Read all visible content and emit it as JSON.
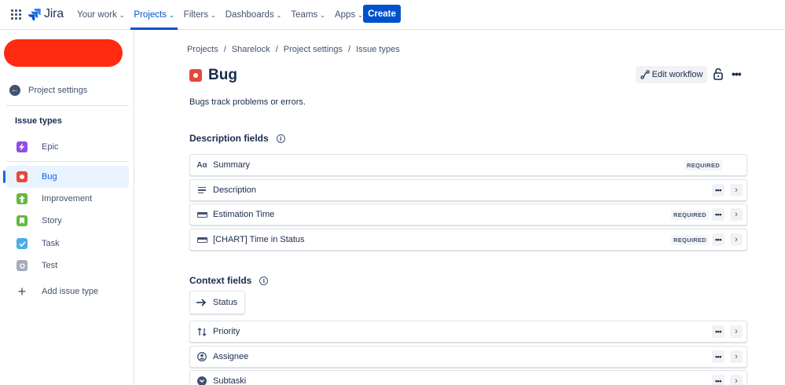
{
  "nav": {
    "logo": "Jira",
    "items": [
      {
        "label": "Your work",
        "active": false
      },
      {
        "label": "Projects",
        "active": true
      },
      {
        "label": "Filters",
        "active": false
      },
      {
        "label": "Dashboards",
        "active": false
      },
      {
        "label": "Teams",
        "active": false
      },
      {
        "label": "Apps",
        "active": false
      }
    ],
    "create": "Create"
  },
  "sidebar": {
    "back_label": "Project settings",
    "heading": "Issue types",
    "items": [
      {
        "label": "Epic",
        "icon": "epic-icon",
        "color": "#904ee2"
      },
      {
        "label": "Bug",
        "icon": "bug-icon",
        "color": "#e5493a",
        "selected": true
      },
      {
        "label": "Improvement",
        "icon": "improvement-icon",
        "color": "#63ba3c"
      },
      {
        "label": "Story",
        "icon": "story-icon",
        "color": "#63ba3c"
      },
      {
        "label": "Task",
        "icon": "task-icon",
        "color": "#4bade8"
      },
      {
        "label": "Test",
        "icon": "test-icon",
        "color": "#a5adba"
      }
    ],
    "add_label": "Add issue type"
  },
  "breadcrumb": [
    "Projects",
    "Sharelock",
    "Project settings",
    "Issue types"
  ],
  "page": {
    "title": "Bug",
    "subtitle": "Bugs track problems or errors.",
    "edit_workflow": "Edit workflow"
  },
  "description_fields": {
    "heading": "Description fields",
    "items": [
      {
        "label": "Summary",
        "required": "REQUIRED",
        "icon": "text-icon"
      },
      {
        "label": "Description",
        "required": "",
        "icon": "paragraph-icon"
      },
      {
        "label": "Estimation Time",
        "required": "REQUIRED",
        "icon": "field-box-icon"
      },
      {
        "label": "[CHART] Time in Status",
        "required": "REQUIRED",
        "icon": "field-box-icon"
      }
    ]
  },
  "context_fields": {
    "heading": "Context fields",
    "status": "Status",
    "items": [
      {
        "label": "Priority",
        "icon": "priority-icon"
      },
      {
        "label": "Assignee",
        "icon": "assignee-icon"
      },
      {
        "label": "Subtaski",
        "icon": "subtask-icon"
      }
    ]
  },
  "glyphs": {
    "summary": "Aα",
    "info": "i",
    "chevron": "⌄",
    "more": "•••",
    "arrow_right": "›",
    "back": "←",
    "plus": "+"
  },
  "colors": {
    "accent": "#0052cc",
    "bug": "#e5493a",
    "redaction": "#ff2a0f"
  }
}
